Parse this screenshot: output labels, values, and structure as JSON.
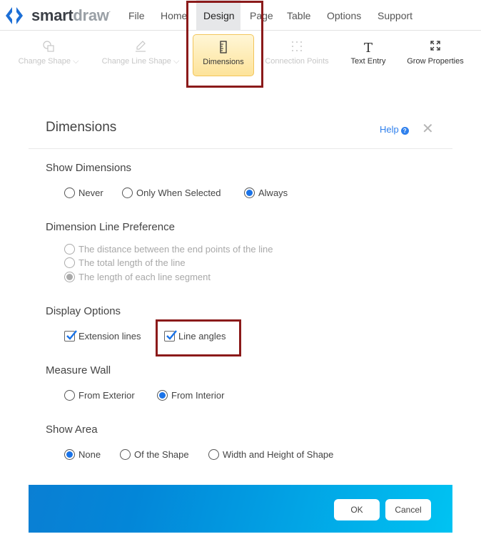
{
  "app": {
    "brand_part1": "smart",
    "brand_part2": "draw",
    "trademark": "·"
  },
  "menu": [
    "File",
    "Home",
    "Design",
    "Page",
    "Table",
    "Options",
    "Support"
  ],
  "menu_active": "Design",
  "ribbon": [
    {
      "label": "Change Shape",
      "icon": "change-shape-icon",
      "state": "disabled",
      "dropdown": true
    },
    {
      "label": "Change Line Shape",
      "icon": "pen-icon",
      "state": "disabled",
      "dropdown": true
    },
    {
      "label": "Dimensions",
      "icon": "ruler-icon",
      "state": "selected"
    },
    {
      "label": "Connection Points",
      "icon": "dots-grid-icon",
      "state": "disabled"
    },
    {
      "label": "Text Entry",
      "icon": "text-icon",
      "state": "normal"
    },
    {
      "label": "Grow Properties",
      "icon": "expand-icon",
      "state": "normal"
    }
  ],
  "ribbon_glyphs": {
    "text": "T",
    "chevron": "⌵"
  },
  "dialog": {
    "title": "Dimensions",
    "help_label": "Help",
    "help_glyph": "?",
    "close_glyph": "✕",
    "sections": {
      "show_dimensions": {
        "title": "Show Dimensions",
        "options": [
          "Never",
          "Only When Selected",
          "Always"
        ],
        "selected": "Always"
      },
      "line_preference": {
        "title": "Dimension Line Preference",
        "options": [
          "The distance between the end points of the line",
          "The total length of the line",
          "The length of each line segment"
        ],
        "selected": "The length of each line segment",
        "disabled": true
      },
      "display_options": {
        "title": "Display Options",
        "options": [
          {
            "label": "Extension lines",
            "checked": true
          },
          {
            "label": "Line angles",
            "checked": true
          }
        ]
      },
      "measure_wall": {
        "title": "Measure Wall",
        "options": [
          "From Exterior",
          "From Interior"
        ],
        "selected": "From Interior"
      },
      "show_area": {
        "title": "Show Area",
        "options": [
          "None",
          "Of the Shape",
          "Width and Height of Shape"
        ],
        "selected": "None"
      }
    },
    "ok_label": "OK",
    "cancel_label": "Cancel"
  },
  "colors": {
    "accent": "#1a73e8",
    "highlight_box": "#8b1a1a",
    "link": "#2f80ed"
  }
}
